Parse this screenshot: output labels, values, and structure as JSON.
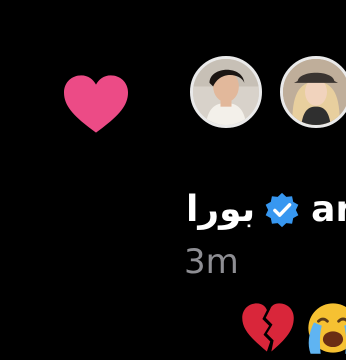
{
  "reply": {
    "name": "بورا",
    "handle": "ar",
    "time": "3m"
  },
  "icons": {
    "like": "heart-icon",
    "verified": "verified-badge-icon",
    "reactions": [
      "broken-heart-icon",
      "loudly-crying-face-icon"
    ]
  },
  "colors": {
    "background": "#000000",
    "heart": "#ec4b86",
    "verified": "#3797f0",
    "time_text": "#8e8e93"
  }
}
